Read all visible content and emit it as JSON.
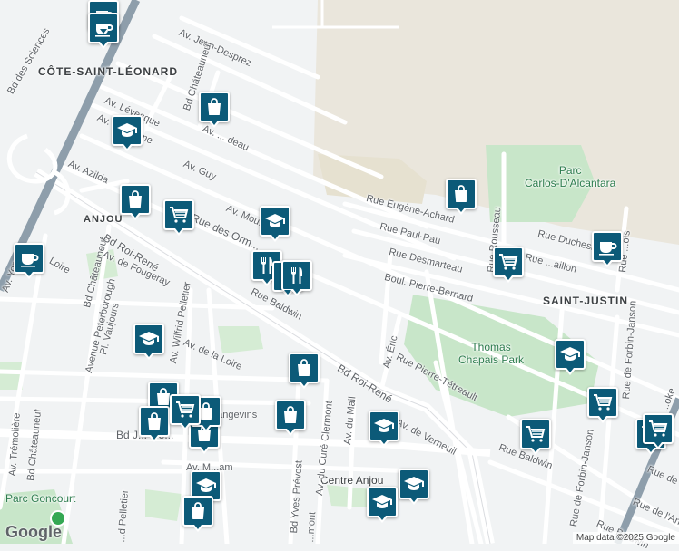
{
  "map": {
    "colors": {
      "background": "#f1f3f4",
      "road": "#ffffff",
      "road_outline": "#dadce0",
      "highway": "#8e9eab",
      "park": "#c8e6c9",
      "industrial": "#eae6dc",
      "pin": "#0c5a78"
    },
    "areas": {
      "cote_saint_leonard": "CÔTE-SAINT-LÉONARD",
      "anjou": "ANJOU",
      "saint_justin": "SAINT-JUSTIN"
    },
    "parks": {
      "carlos": "Parc\nCarlos-D'Alcantara",
      "thomas": "Thomas\nChapais Park",
      "goncourt": "Parc Goncourt",
      "centre_anjou": "Centre Anjou"
    },
    "streets": {
      "jean_desprez": "Av. Jean-Desprez",
      "bd_des_sciences": "Bd des Sciences",
      "bd_chateauneuf_top": "Bd Châteauneuf",
      "av_levesque": "Av. Lévesque",
      "av_rheaume": "Av. Rhéaume",
      "av_deau": "Av. ... deau",
      "av_guy": "Av. Guy",
      "av_azilda": "Av. Azilda",
      "av_mou": "Av. Mou...",
      "rue_des_ormeaux": "Rue des Orm...",
      "rue_eugene_achard": "Rue Eugène-Achard",
      "rue_paul_pau": "Rue Paul-Pau",
      "rue_desmarteau": "Rue Desmarteau",
      "boul_pierre_bernard": "Boul. Pierre-Bernard",
      "rue_rousseau": "Rue Rousseau",
      "rue_duchesneau": "Rue Duchesneau",
      "rue_baillon": "Rue ...aillon",
      "rue_benoit": "Rue ...ois",
      "bd_chateauneuf_mid": "Bd Châteauneuf",
      "bd_roi_rene_w": "Bd Roi-René",
      "av_de_fougeray": "Av. de Fougeray",
      "rue_loire": "Loire",
      "av_yon": "Av. Yon",
      "rue_baldwin_w": "Rue Baldwin",
      "av_wilfrid_pelletier": "Av. Wilfrid Pelletier",
      "avenue_peterborough": "Avenue Peterborough",
      "pl_vaujours": "Pl. Vaujours",
      "av_de_la_loire": "Av. de la Loire",
      "bd_roi_rene_e": "Bd Roi-René",
      "av_eric": "Av. Éric",
      "rue_pierre_tetreault": "Rue Pierre-Tétreault",
      "rue_de_forbin_janson_e": "Rue de Forbin-Janson",
      "av_du_cure_clermont": "Av. du Curé Clermont",
      "av_du_mail": "Av. du Mail",
      "av_de_verneuil": "Av. de Verneuil",
      "rue_baldwin_e": "Rue Baldwin",
      "rue_de_forbin_janson_s": "Rue de Forbin-Janson",
      "rue_de_ange": "Rue de l'Ange...",
      "av_tremoliere": "Av. Trémolière",
      "bd_chateauneuf_bottom": "Bd Châteauneuf",
      "bd_joseph_renaud": "Bd J...-Re...",
      "av_langevins": "...angevins",
      "av_yves_prevost": "Bd Yves Prévost",
      "av_m_yam": "Av. M...am",
      "rue_pelletier": "...d Pelletier",
      "rue_mont": "...mont",
      "rue_baldwin_s": "Rue Baldwin",
      "rue_brook": "...oke",
      "rue_de_e": "Rue de"
    },
    "poi_pins": [
      {
        "type": "cafe",
        "label": "coffee-cup-icon"
      },
      {
        "type": "cafe",
        "label": "coffee-cup-icon"
      },
      {
        "type": "school",
        "label": "graduation-cap-icon"
      },
      {
        "type": "shop",
        "label": "shopping-bag-icon"
      },
      {
        "type": "shop",
        "label": "shopping-bag-icon"
      },
      {
        "type": "grocery",
        "label": "shopping-cart-icon"
      },
      {
        "type": "school",
        "label": "graduation-cap-icon"
      },
      {
        "type": "restaurant",
        "label": "fork-knife-icon"
      },
      {
        "type": "restaurant",
        "label": "fork-knife-icon"
      },
      {
        "type": "restaurant",
        "label": "fork-knife-icon"
      },
      {
        "type": "cafe",
        "label": "coffee-cup-icon"
      },
      {
        "type": "shop",
        "label": "shopping-bag-icon"
      },
      {
        "type": "grocery",
        "label": "shopping-cart-icon"
      },
      {
        "type": "cafe",
        "label": "coffee-cup-icon"
      },
      {
        "type": "school",
        "label": "graduation-cap-icon"
      },
      {
        "type": "shop",
        "label": "shopping-bag-icon"
      },
      {
        "type": "school",
        "label": "graduation-cap-icon"
      },
      {
        "type": "grocery",
        "label": "shopping-cart-icon"
      },
      {
        "type": "shop",
        "label": "shopping-bag-icon"
      },
      {
        "type": "grocery",
        "label": "shopping-cart-icon"
      },
      {
        "type": "shop",
        "label": "shopping-bag-icon"
      },
      {
        "type": "shop",
        "label": "shopping-bag-icon"
      },
      {
        "type": "shop",
        "label": "shopping-bag-icon"
      },
      {
        "type": "school",
        "label": "graduation-cap-icon"
      },
      {
        "type": "shop",
        "label": "shopping-bag-icon"
      },
      {
        "type": "school",
        "label": "graduation-cap-icon"
      },
      {
        "type": "grocery",
        "label": "shopping-cart-icon"
      },
      {
        "type": "grocery",
        "label": "shopping-cart-icon"
      },
      {
        "type": "grocery",
        "label": "shopping-cart-icon"
      },
      {
        "type": "school",
        "label": "graduation-cap-icon"
      },
      {
        "type": "school",
        "label": "graduation-cap-icon"
      },
      {
        "type": "shop",
        "label": "shopping-bag-icon"
      }
    ],
    "google_logo": "Google",
    "attribution": "Map data ©2025 Google"
  }
}
